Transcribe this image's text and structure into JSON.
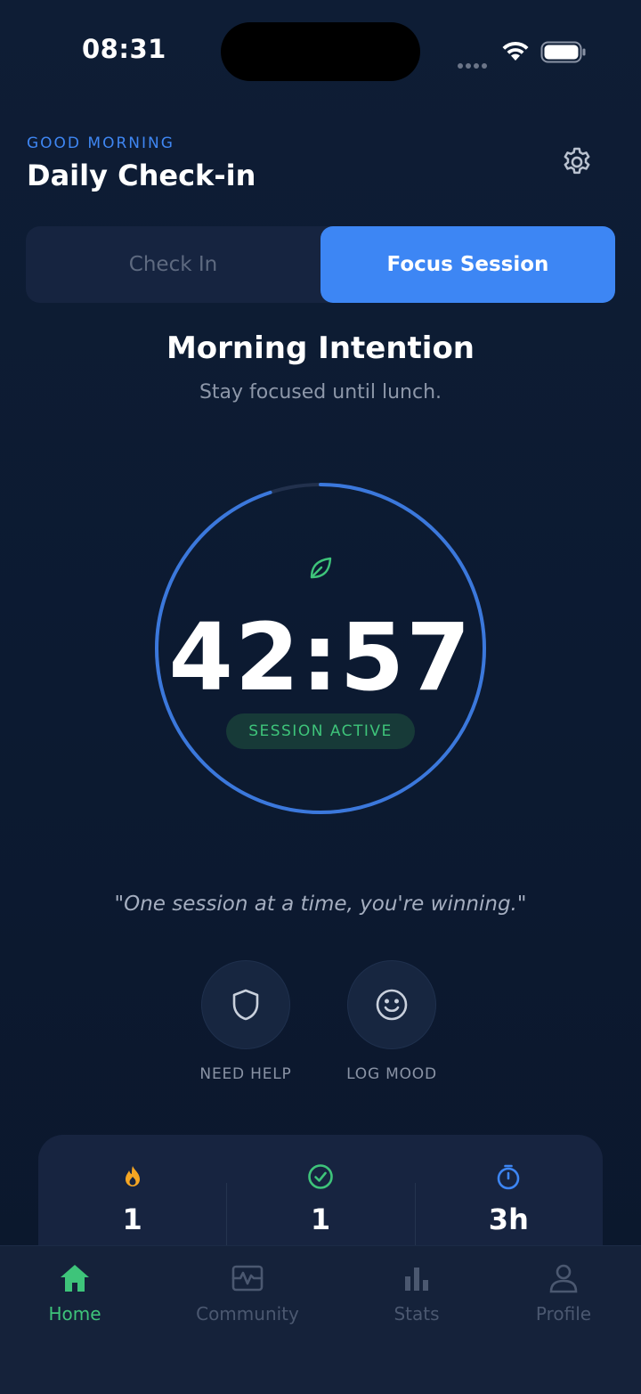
{
  "status_bar": {
    "time": "08:31"
  },
  "header": {
    "greeting": "GOOD MORNING",
    "title": "Daily Check-in"
  },
  "segment": {
    "tabs": [
      {
        "label": "Check In",
        "active": false
      },
      {
        "label": "Focus Session",
        "active": true
      }
    ]
  },
  "intention": {
    "title": "Morning Intention",
    "subtitle": "Stay focused until lunch."
  },
  "timer": {
    "value": "42:57",
    "badge": "SESSION ACTIVE",
    "progress": 0.95
  },
  "quote": "\"One session at a time, you're winning.\"",
  "actions": [
    {
      "label": "NEED HELP",
      "icon": "shield-icon"
    },
    {
      "label": "LOG MOOD",
      "icon": "smile-icon"
    }
  ],
  "stats": [
    {
      "icon": "flame-icon",
      "value": "1"
    },
    {
      "icon": "check-circle-icon",
      "value": "1"
    },
    {
      "icon": "stopwatch-icon",
      "value": "3h"
    }
  ],
  "tab_bar": {
    "items": [
      {
        "label": "Home",
        "icon": "home-icon",
        "active": true
      },
      {
        "label": "Community",
        "icon": "community-icon",
        "active": false
      },
      {
        "label": "Stats",
        "icon": "bar-chart-icon",
        "active": false
      },
      {
        "label": "Profile",
        "icon": "profile-icon",
        "active": false
      }
    ]
  },
  "colors": {
    "background": "#0c1a30",
    "accent_blue": "#3d86f4",
    "accent_green": "#3ec47a",
    "flame_orange": "#f5a623"
  }
}
